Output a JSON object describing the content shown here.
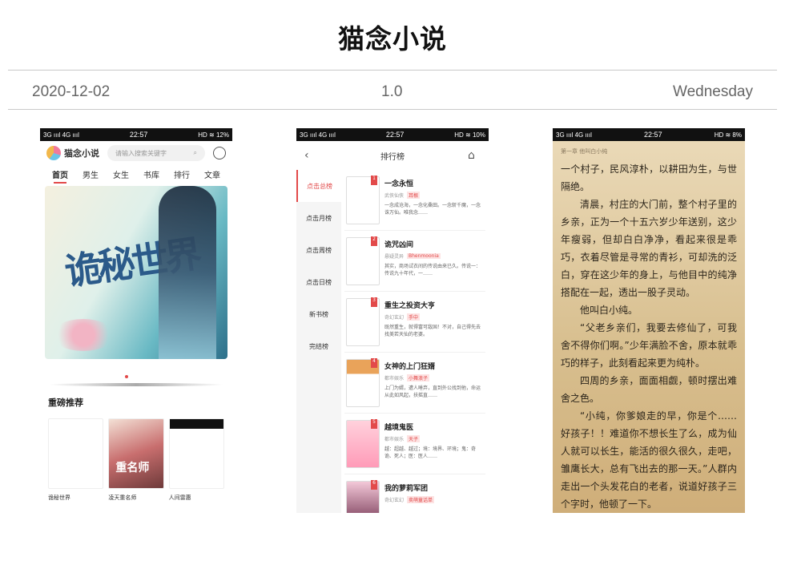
{
  "header": {
    "title": "猫念小说",
    "date": "2020-12-02",
    "version": "1.0",
    "weekday": "Wednesday"
  },
  "phones": {
    "status_left": "3G ıııl 4G ıııl",
    "status_time": "22:57",
    "status_right_1": "HD ≋ 12%",
    "status_right_2": "HD ≋ 10%",
    "status_right_3": "HD ≋ 8%"
  },
  "phone1": {
    "logo_text": "猫念小说",
    "search_placeholder": "请输入搜索关键字",
    "nav": [
      "首页",
      "男生",
      "女生",
      "书库",
      "排行",
      "文章"
    ],
    "section_title": "重磅推荐",
    "book_titles": [
      "诡秘世界",
      "凌天重名师",
      "人间雷惠"
    ],
    "cover2_text": "重名师"
  },
  "phone2": {
    "title": "排行榜",
    "sidebar": [
      "点击总榜",
      "点击月榜",
      "点击周榜",
      "点击日榜",
      "新书榜",
      "完结榜"
    ],
    "items": [
      {
        "rank": "1",
        "title": "一念永恒",
        "genre": "武侠仙侠",
        "tag": "耳根",
        "desc": "一念成沧海，一念化桑田。一念斩千魔，一念诛万仙。唯我念……"
      },
      {
        "rank": "2",
        "title": "诡咒凶间",
        "genre": "悬疑灵异",
        "tag": "Bhenmoonia",
        "desc": "其实，商场试衣间的传说由来已久。传说一：传说九十年代，一……"
      },
      {
        "rank": "3",
        "title": "重生之投资大亨",
        "genre": "奇幻玄幻",
        "tag": "手中",
        "desc": "既然重生，就得富可敌国！不对，自己得先去找美若天仙的老婆。"
      },
      {
        "rank": "4",
        "title": "女神的上门狂婿",
        "genre": "都市娱乐",
        "tag": "小舞浪子",
        "desc": "上门为婿，遭人唾弃，直到外公找到他，命运从此如风起，扶摇直……"
      },
      {
        "rank": "5",
        "title": "越境鬼医",
        "genre": "都市娱乐",
        "tag": "天子",
        "desc": "越：超越、越过；境：境界、环境；鬼：奇诡、死人；医：医人……"
      },
      {
        "rank": "6",
        "title": "我的萝莉军团",
        "genre": "奇幻玄幻",
        "tag": "卖萌童话单",
        "desc": ""
      }
    ]
  },
  "phone3": {
    "chapter": "第一章 他叫白小纯",
    "paragraphs": [
      {
        "text": "一个村子，民风淳朴，以耕田为生，与世隔绝。",
        "indent": false
      },
      {
        "text": "清晨，村庄的大门前，整个村子里的乡亲，正为一个十五六岁少年送别，这少年瘦弱，但却白白净净，看起来很是乖巧，衣着尽管是寻常的青衫，可却洗的泛白，穿在这少年的身上，与他目中的纯净搭配在一起，透出一股子灵动。",
        "indent": true
      },
      {
        "text": "他叫白小纯。",
        "indent": true
      },
      {
        "text": "“父老乡亲们，我要去修仙了，可我舍不得你们啊。”少年满脸不舍，原本就乖巧的样子，此刻看起来更为纯朴。",
        "indent": true
      },
      {
        "text": "四周的乡亲，面面相觑，顿时摆出难舍之色。",
        "indent": true
      },
      {
        "text": "“小纯，你爹娘走的早，你是个……好孩子！！难道你不想长生了么，成为仙人就可以长生，能活的很久很久，走吧，雏鹰长大，总有飞出去的那一天。”人群内走出一个头发花白的老者，说道好孩子三个字时，他顿了一下。",
        "indent": true
      }
    ]
  }
}
